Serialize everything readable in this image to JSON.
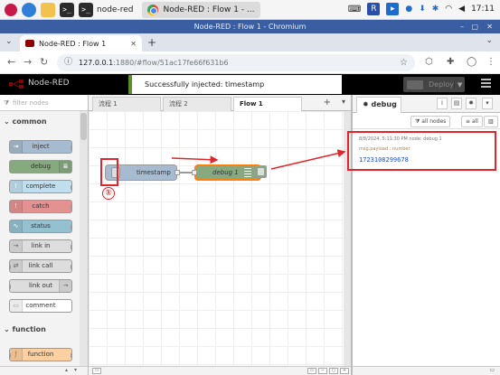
{
  "taskbar": {
    "terminal_title": "node-red",
    "chrome_task": "Node-RED : Flow 1 - ...",
    "clock": "17:11"
  },
  "window": {
    "title": "Node-RED : Flow 1 - Chromium"
  },
  "browser": {
    "tab_title": "Node-RED : Flow 1",
    "url_host": "127.0.0.1",
    "url_path": ":1880/#flow/51ac17fe66f631b6"
  },
  "header": {
    "app_name": "Node-RED",
    "deploy_label": "Deploy"
  },
  "notification": {
    "text": "Successfully injected: timestamp"
  },
  "palette": {
    "filter_placeholder": "filter nodes",
    "categories": [
      {
        "name": "common",
        "nodes": [
          "inject",
          "debug",
          "complete",
          "catch",
          "status",
          "link in",
          "link call",
          "link out",
          "comment"
        ]
      },
      {
        "name": "function",
        "nodes": [
          "function"
        ]
      }
    ]
  },
  "workspace": {
    "tabs": [
      "流程 1",
      "流程 2",
      "Flow 1"
    ],
    "active_tab": "Flow 1",
    "nodes": {
      "inject_label": "timestamp",
      "debug_label": "debug 1"
    },
    "annotation_marker": "①"
  },
  "sidebar": {
    "tab_label": "debug",
    "filter_nodes": "all nodes",
    "filter_all": "all",
    "message": {
      "meta": "8/8/2024, 5:11:30 PM    node: debug 1",
      "topic": "msg.payload : number",
      "value": "1723108299678"
    }
  },
  "colors": {
    "header_bg": "#000000",
    "inject_node": "#a6bbcf",
    "debug_node": "#87a980",
    "annotation_red": "#e0262c",
    "notification_accent": "#5a8f2b"
  }
}
